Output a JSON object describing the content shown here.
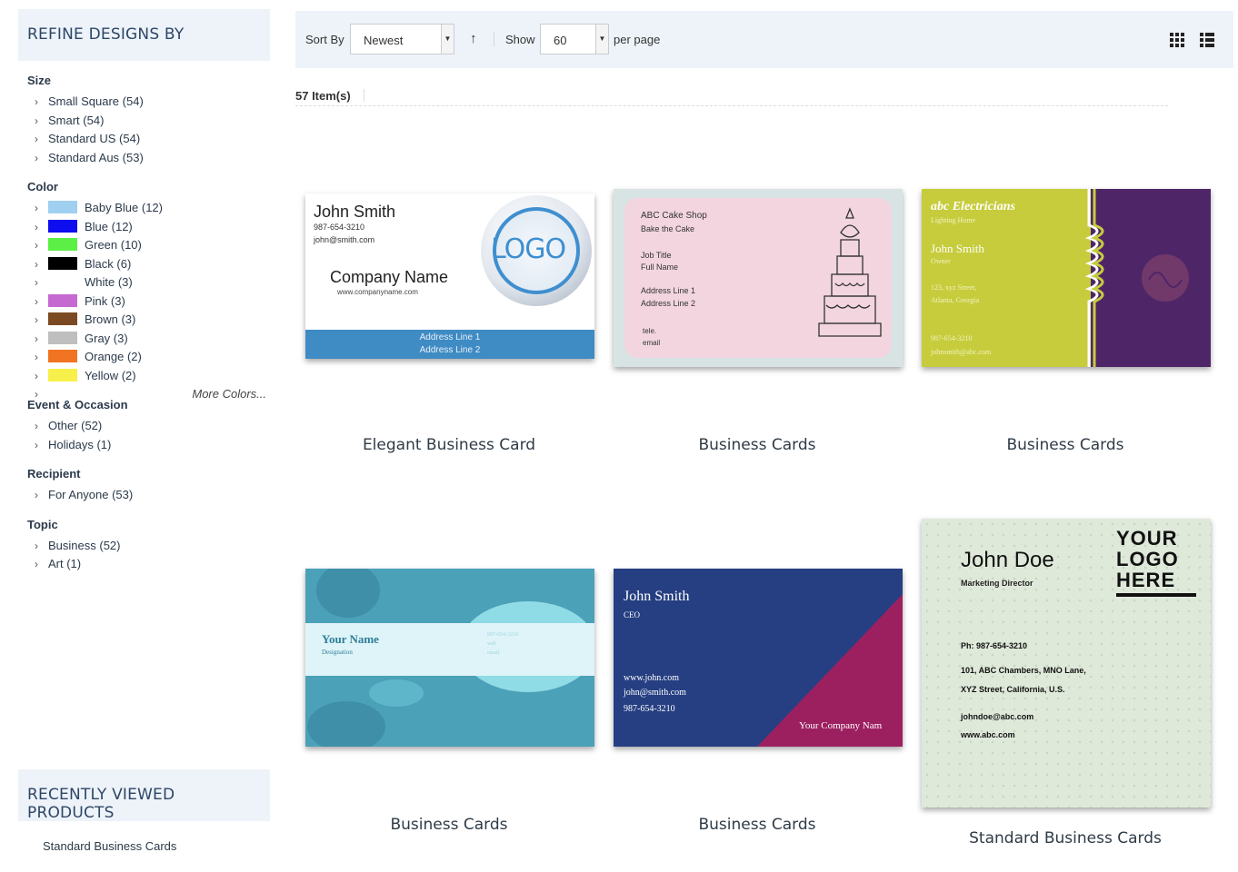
{
  "sidebar": {
    "heading": "REFINE DESIGNS BY",
    "size": {
      "title": "Size",
      "items": [
        "Small Square  (54)",
        "Smart  (54)",
        "Standard US  (54)",
        "Standard Aus  (53)"
      ]
    },
    "color": {
      "title": "Color",
      "items": [
        {
          "label": "Baby Blue (12)",
          "color": "#9fd0f0"
        },
        {
          "label": "Blue (12)",
          "color": "#0d0df0"
        },
        {
          "label": "Green (10)",
          "color": "#5cf046"
        },
        {
          "label": "Black (6)",
          "color": "#000000"
        },
        {
          "label": "White (3)",
          "color": "#ffffff"
        },
        {
          "label": "Pink (3)",
          "color": "#c56ad0"
        },
        {
          "label": "Brown (3)",
          "color": "#7b4a22"
        },
        {
          "label": "Gray (3)",
          "color": "#bfbfbf"
        },
        {
          "label": "Orange (2)",
          "color": "#f07422"
        },
        {
          "label": "Yellow (2)",
          "color": "#f8f04a"
        }
      ],
      "more": "More Colors..."
    },
    "event": {
      "title": "Event & Occasion",
      "items": [
        "Other (52)",
        "Holidays (1)"
      ]
    },
    "recipient": {
      "title": "Recipient",
      "items": [
        "For Anyone (53)"
      ]
    },
    "topic": {
      "title": "Topic",
      "items": [
        "Business (52)",
        "Art (1)"
      ]
    }
  },
  "recent": {
    "heading": "RECENTLY VIEWED PRODUCTS",
    "items": [
      "Standard Business Cards"
    ]
  },
  "toolbar": {
    "sort_label": "Sort By",
    "sort_value": "Newest",
    "show_label": "Show",
    "show_value": "60",
    "per_page": "per page"
  },
  "item_count": "57 Item(s)",
  "products": [
    {
      "title": "Elegant Business Card",
      "card": {
        "name": "John Smith",
        "phone": "987-654-3210",
        "email": "john@smith.com",
        "company": "Company Name",
        "web": "www.companyname.com",
        "logo": "LOGO",
        "addr1": "Address Line 1",
        "addr2": "Address Line 2"
      }
    },
    {
      "title": "Business Cards",
      "card": {
        "l1": "ABC Cake Shop",
        "l2": "Bake the Cake",
        "l3": "Job Title",
        "l4": "Full Name",
        "l5": "Address Line 1",
        "l6": "Address Line 2",
        "l7": "tele.",
        "l8": "email"
      }
    },
    {
      "title": "Business Cards",
      "card": {
        "company": "abc Electricians",
        "tag": "Lighting Home",
        "name": "John Smith",
        "role": "Owner",
        "addr1": "123, xyz Street,",
        "addr2": "Atlanta, Georgia",
        "phone": "987-654-3210",
        "email": "johnsmith@abc.com"
      }
    },
    {
      "title": "Business Cards",
      "card": {
        "name": "Your Name",
        "desig": "Designation",
        "phone": "987-654-3210",
        "web": "web",
        "email": "email"
      }
    },
    {
      "title": "Business Cards",
      "card": {
        "name": "John Smith",
        "role": "CEO",
        "web": "www.john.com",
        "email": "john@smith.com",
        "phone": "987-654-3210",
        "company": "Your Company Nam"
      }
    },
    {
      "title": "Standard Business Cards",
      "card": {
        "name": "John Doe",
        "role": "Marketing Director",
        "logo1": "YOUR",
        "logo2": "LOGO",
        "logo3": "HERE",
        "phone": "Ph: 987-654-3210",
        "addr1": "101, ABC Chambers, MNO Lane,",
        "addr2": "XYZ Street, California, U.S.",
        "email": "johndoe@abc.com",
        "web": "www.abc.com"
      }
    }
  ]
}
